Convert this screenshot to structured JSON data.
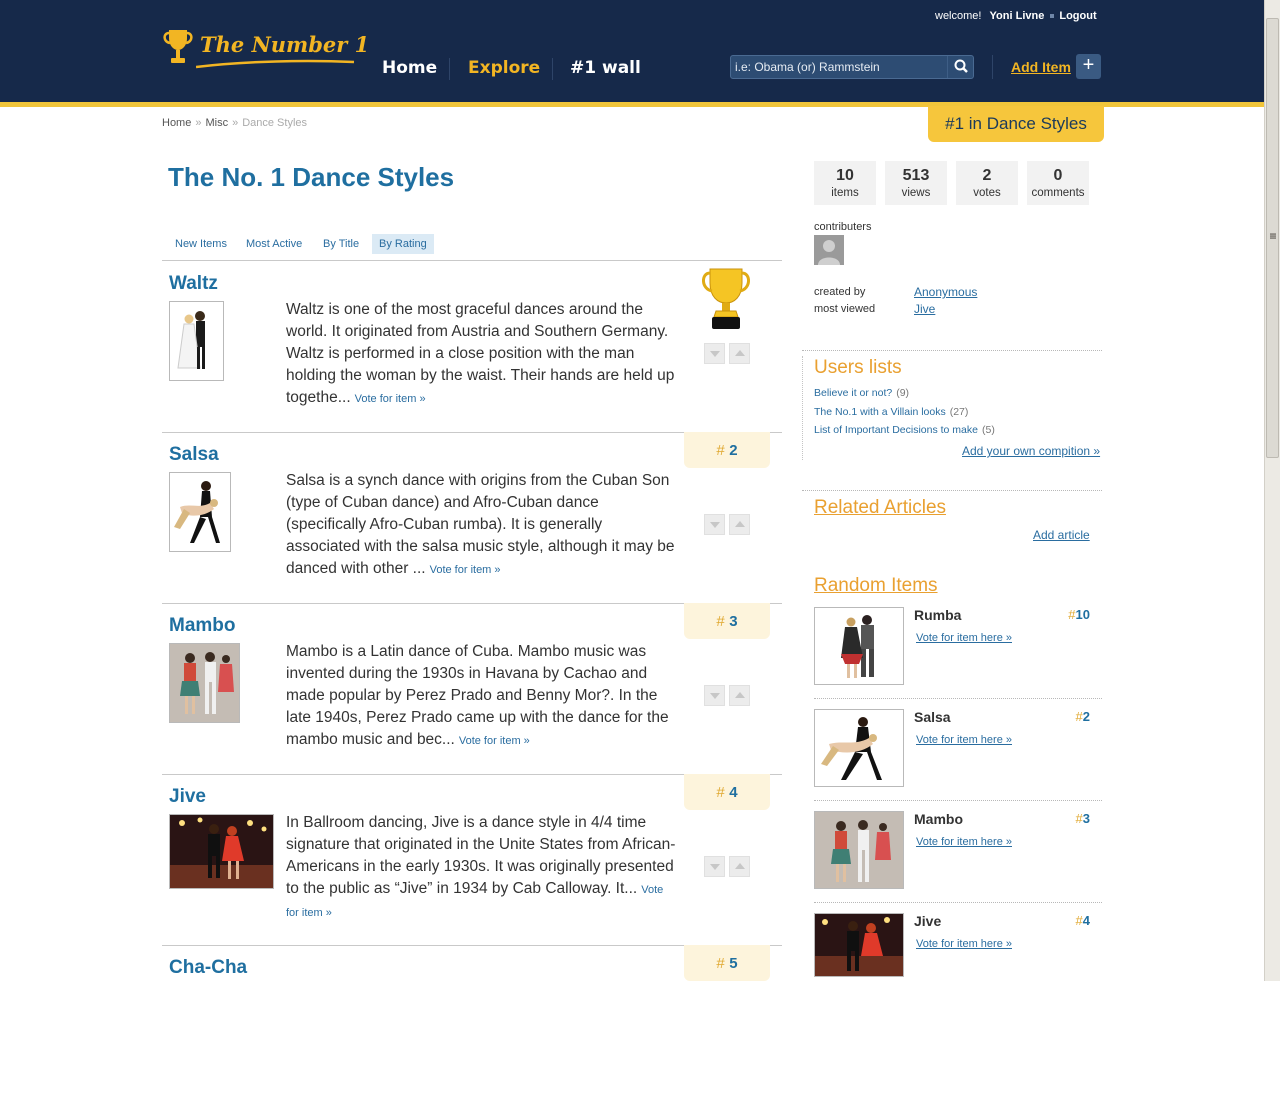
{
  "header": {
    "logo_text": "The Number 1",
    "nav": [
      "Home",
      "Explore",
      "#1 wall"
    ],
    "welcome_label": "welcome!",
    "user_name": "Yoni Livne",
    "logout": "Logout",
    "search_placeholder": "i.e: Obama (or) Rammstein",
    "add_item": "Add Item",
    "add_plus": "+"
  },
  "breadcrumb": {
    "home": "Home",
    "sep1": "»",
    "misc": "Misc",
    "sep2": "»",
    "current": "Dance Styles"
  },
  "rank_badge": "#1 in Dance Styles",
  "page_title": "The No. 1 Dance Styles",
  "tabs": [
    "New Items",
    "Most Active",
    "By Title",
    "By Rating"
  ],
  "active_tab": "By Rating",
  "vote_link": "Vote for item »",
  "items": [
    {
      "title": "Waltz",
      "rank_hash": "#",
      "rank": "1",
      "desc": "Waltz is one of the most graceful dances around the world. It originated from Austria and Southern Germany. Waltz is performed in a close position with the man holding the woman by the waist. Their hands are held up togethe..."
    },
    {
      "title": "Salsa",
      "rank_hash": "#",
      "rank": "2",
      "desc": "Salsa is a synch dance with origins from the Cuban Son (type of Cuban dance) and Afro-Cuban dance (specifically Afro-Cuban rumba). It is generally associated with the salsa music style, although it may be danced with other ..."
    },
    {
      "title": "Mambo",
      "rank_hash": "#",
      "rank": "3",
      "desc": "Mambo is a Latin dance of Cuba. Mambo music was invented during the 1930s in Havana by Cachao and made popular by Perez Prado and Benny Mor?. In the late 1940s, Perez Prado came up with the dance for the mambo music and bec..."
    },
    {
      "title": "Jive",
      "rank_hash": "#",
      "rank": "4",
      "desc": "In Ballroom dancing, Jive is a dance style in 4/4 time signature that originated in the Unite States from African-Americans in the early 1930s. It was originally presented to the public as “Jive” in 1934 by Cab Calloway. It..."
    },
    {
      "title": "Cha-Cha",
      "rank_hash": "#",
      "rank": "5",
      "desc": ""
    }
  ],
  "stats": [
    {
      "num": "10",
      "label": "items"
    },
    {
      "num": "513",
      "label": "views"
    },
    {
      "num": "2",
      "label": "votes"
    },
    {
      "num": "0",
      "label": "comments"
    }
  ],
  "contributers_label": "contributers",
  "created_by_label": "created by",
  "created_by": "Anonymous",
  "most_viewed_label": "most viewed",
  "most_viewed": "Jive",
  "users_lists": {
    "title": "Users lists",
    "items": [
      {
        "label": "Believe it or not?",
        "count": "(9)"
      },
      {
        "label": "The No.1 with a Villain looks",
        "count": "(27)"
      },
      {
        "label": "List of Important Decisions to make",
        "count": "(5)"
      }
    ],
    "add_link": "Add your own compition »"
  },
  "related_articles": {
    "title": "Related Articles",
    "add_link": "Add article"
  },
  "random_items": {
    "title": "Random Items",
    "vote_label": "Vote for item here »",
    "items": [
      {
        "name": "Rumba",
        "hash": "#",
        "rank": "10"
      },
      {
        "name": "Salsa",
        "hash": "#",
        "rank": "2"
      },
      {
        "name": "Mambo",
        "hash": "#",
        "rank": "3"
      },
      {
        "name": "Jive",
        "hash": "#",
        "rank": "4"
      }
    ]
  },
  "colors": {
    "header_bg": "#16294a",
    "accent": "#f1c53a",
    "link": "#1f6fa0",
    "orange_heading": "#e9a030"
  }
}
